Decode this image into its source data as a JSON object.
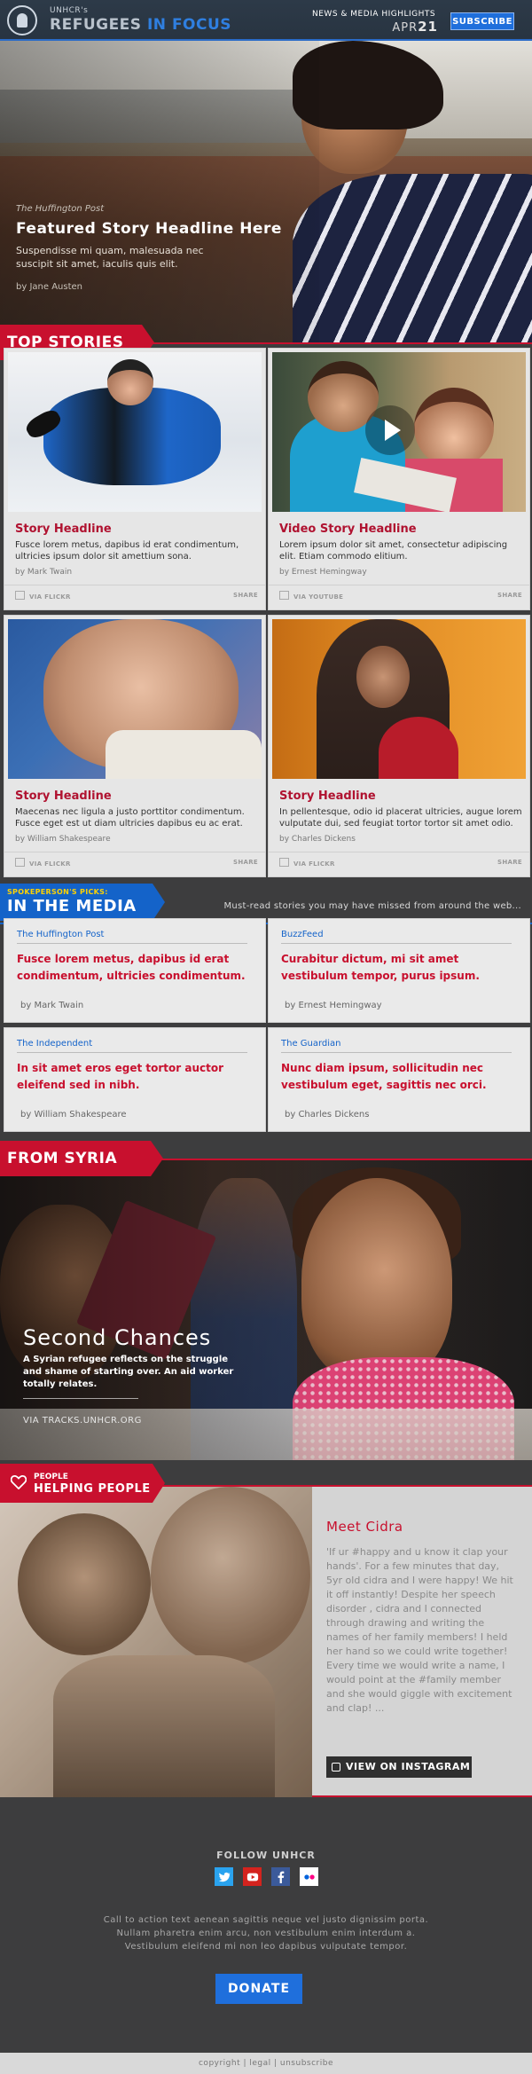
{
  "header": {
    "brand_sub": "UNHCR's",
    "brand_part1": "REFUGEES",
    "brand_part2": "IN FOCUS",
    "highlights": "NEWS & MEDIA HIGHLIGHTS",
    "date_month": "APR",
    "date_day": "21",
    "subscribe": "SUBSCRIBE"
  },
  "hero": {
    "source": "The Huffington Post",
    "headline": "Featured Story Headline Here",
    "summary": "Suspendisse mi quam, malesuada nec suscipit sit amet, iaculis quis elit.",
    "author": "by Jane Austen"
  },
  "top_stories": {
    "label": "TOP STORIES",
    "cards": [
      {
        "title": "Story Headline",
        "text": "Fusce lorem metus, dapibus id erat condimentum, ultricies ipsum dolor sit amettium sona.",
        "by": "by Mark Twain",
        "via": "VIA FLICKR",
        "share": "SHARE"
      },
      {
        "title": "Video Story Headline",
        "text": "Lorem ipsum dolor sit amet, consectetur adipiscing elit. Etiam commodo elitium.",
        "by": "by Ernest Hemingway",
        "via": "VIA YOUTUBE",
        "share": "SHARE"
      },
      {
        "title": "Story Headline",
        "text": "Maecenas nec ligula a justo porttitor condimentum. Fusce eget est ut diam ultricies dapibus eu ac erat.",
        "by": "by William Shakespeare",
        "via": "VIA FLICKR",
        "share": "SHARE"
      },
      {
        "title": "Story Headline",
        "text": "In pellentesque, odio id placerat ultricies, augue lorem vulputate dui, sed feugiat tortor tortor sit amet odio.",
        "by": "by Charles Dickens",
        "via": "VIA FLICKR",
        "share": "SHARE"
      }
    ]
  },
  "media": {
    "pre": "SPOKEPERSON'S PICKS:",
    "label": "IN THE MEDIA",
    "note": "Must-read stories you may have missed from around the web...",
    "items": [
      {
        "outlet": "The Huffington Post",
        "headline": "Fusce lorem metus, dapibus id erat condimentum, ultricies condimentum.",
        "by": "by Mark Twain"
      },
      {
        "outlet": "BuzzFeed",
        "headline": "Curabitur dictum, mi sit amet vestibulum tempor, purus ipsum.",
        "by": "by Ernest Hemingway"
      },
      {
        "outlet": "The Independent",
        "headline": "In sit amet eros eget tortor auctor eleifend sed in nibh.",
        "by": "by William Shakespeare"
      },
      {
        "outlet": "The Guardian",
        "headline": "Nunc diam ipsum, sollicitudin nec vestibulum eget, sagittis nec orci.",
        "by": "by Charles Dickens"
      }
    ]
  },
  "syria": {
    "label": "FROM SYRIA",
    "title": "Second Chances",
    "text": "A Syrian refugee reflects on the struggle and shame of starting over. An aid worker totally relates.",
    "link": "VIA TRACKS.UNHCR.ORG"
  },
  "people": {
    "pre": "PEOPLE",
    "label": "HELPING PEOPLE",
    "title": "Meet Cidra",
    "text": "'If ur #happy and u know it clap your hands'. For a few minutes that day, 5yr old cidra and I were happy! We hit it off instantly! Despite her speech disorder , cidra and I connected through drawing and writing the names of her family members! I held her hand so we could write together! Every time we would write a name, I would point at the #family member and she would giggle with excitement and clap! ...",
    "button": "VIEW ON INSTAGRAM"
  },
  "footer": {
    "follow": "FOLLOW UNHCR",
    "social_icons": [
      "twitter-icon",
      "youtube-icon",
      "facebook-icon",
      "flickr-icon"
    ],
    "cta_line1": "Call to action text aenean sagittis neque vel justo dignissim porta.",
    "cta_line2": "Nullam pharetra enim arcu, non vestibulum enim interdum a.",
    "cta_line3": "Vestibulum eleifend mi non leo dapibus vulputate tempor.",
    "donate": "DONATE",
    "links": "copyright | legal | unsubscribe"
  },
  "colors": {
    "accent_red": "#c8102e",
    "accent_blue": "#1f6fdc",
    "background": "#3d3d3e"
  }
}
